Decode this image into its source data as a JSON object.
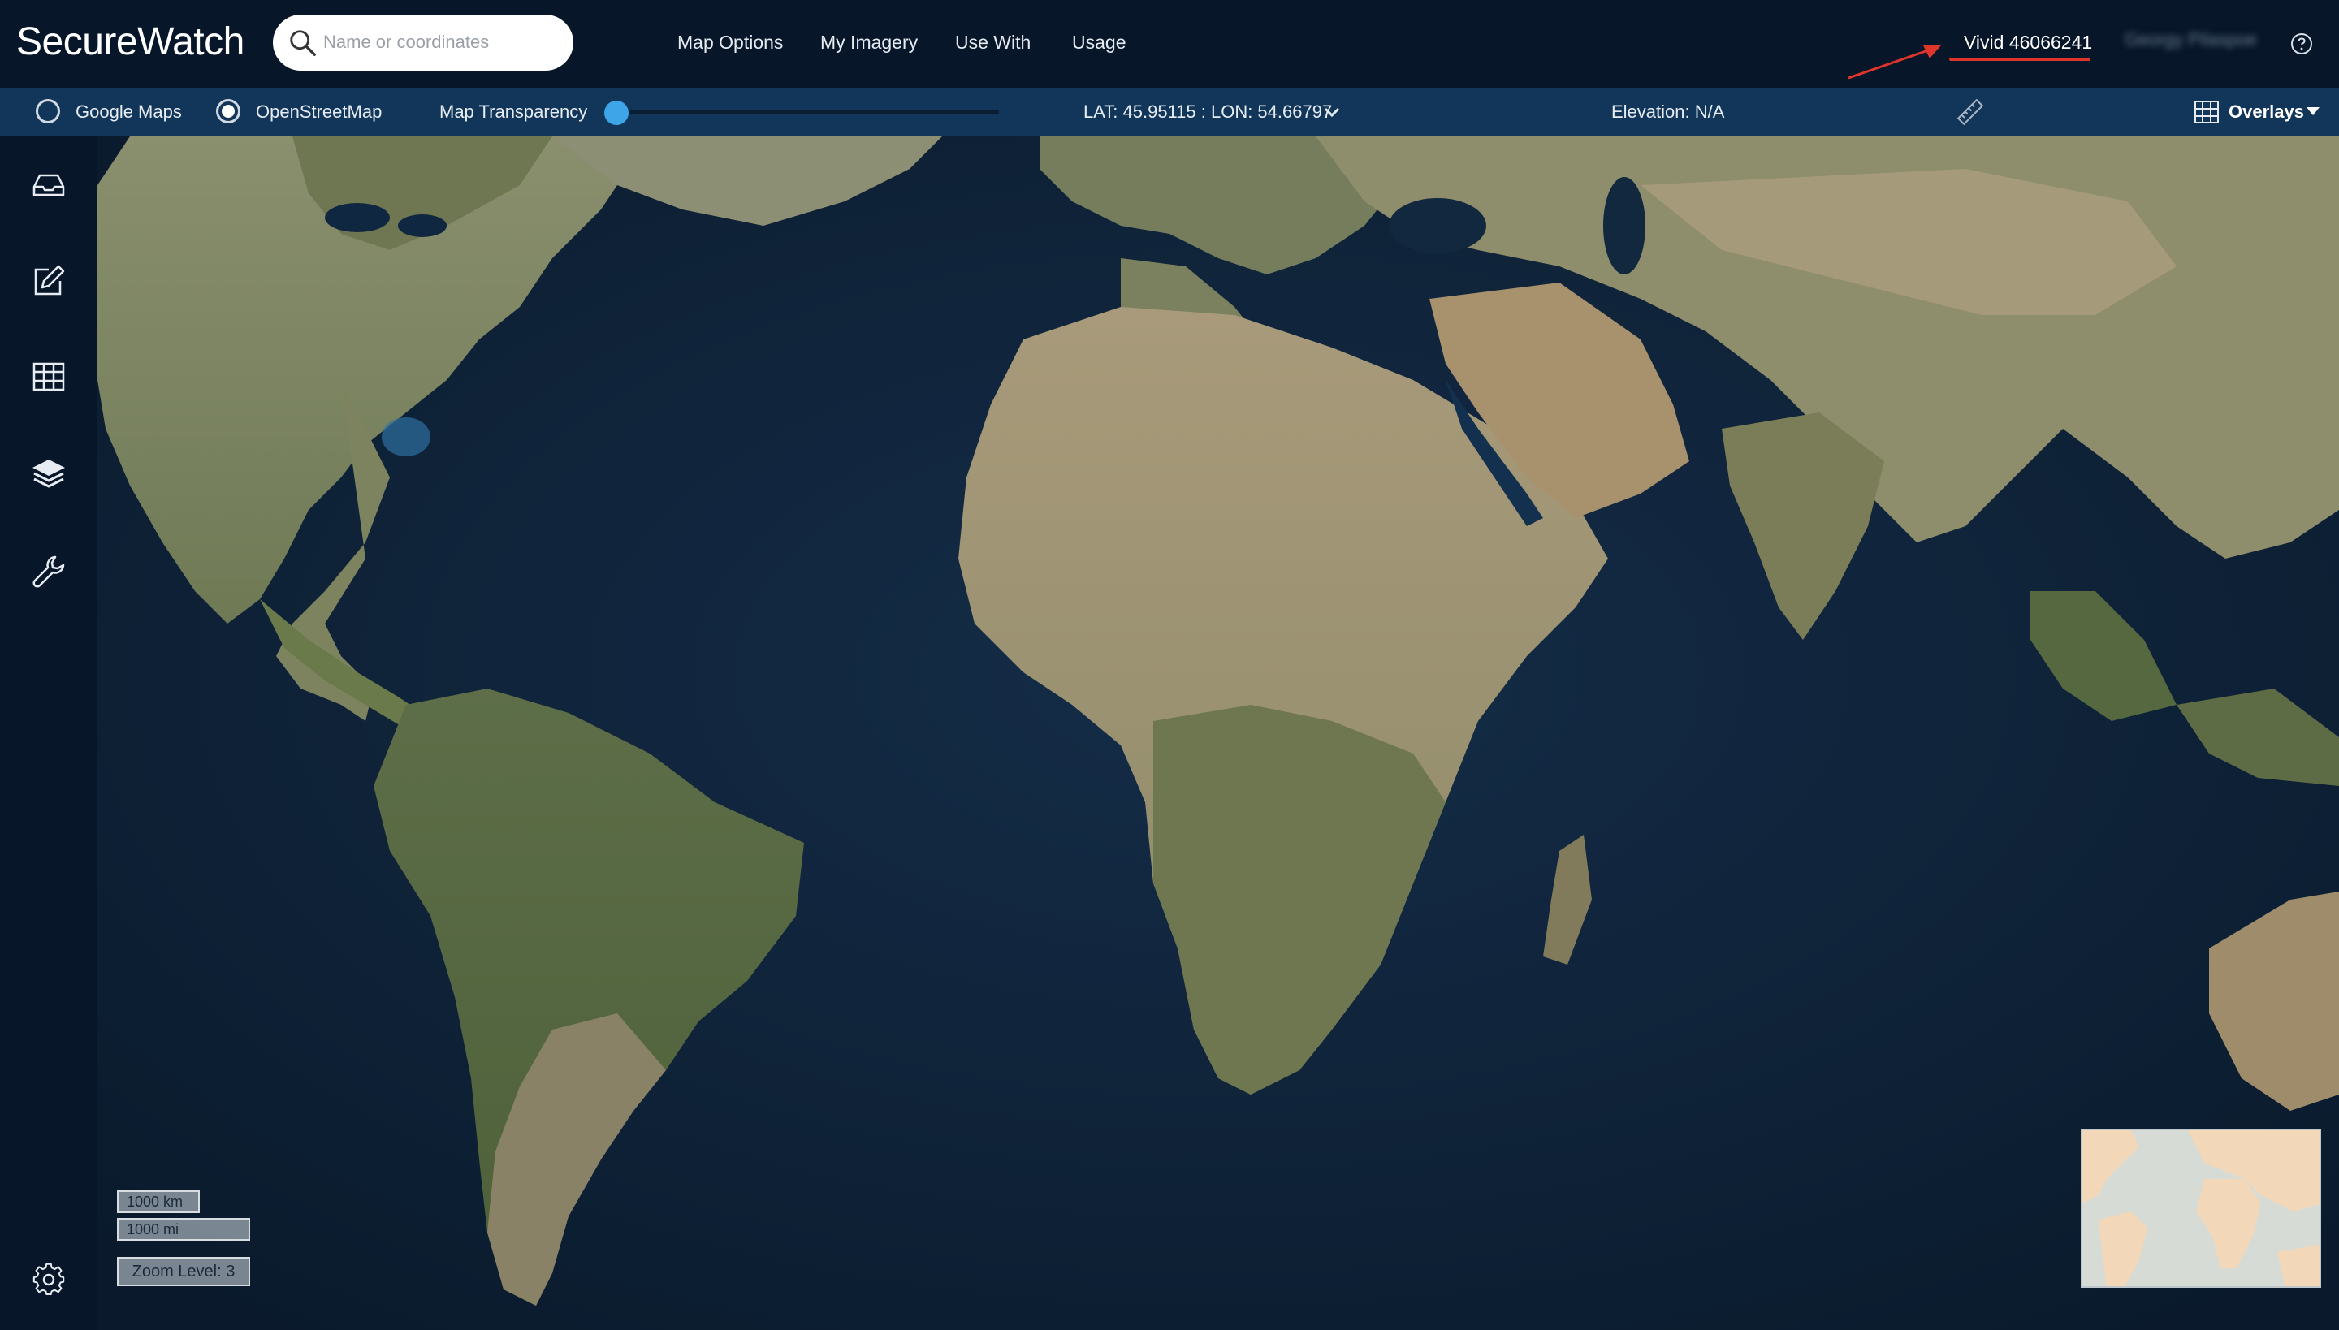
{
  "header": {
    "brand": "SecureWatch",
    "search_placeholder": "Name or coordinates",
    "nav": [
      "Map Options",
      "My Imagery",
      "Use With",
      "Usage"
    ],
    "account": "Vivid 46066241",
    "username": "Georgy Pilaspoe"
  },
  "subbar": {
    "basemaps": [
      {
        "label": "Google Maps",
        "selected": false
      },
      {
        "label": "OpenStreetMap",
        "selected": true
      }
    ],
    "transparency_label": "Map Transparency",
    "transparency_value": 0,
    "coordinates": "LAT: 45.95115 : LON: 54.66797",
    "elevation": "Elevation: N/A",
    "overlays_label": "Overlays"
  },
  "sidebar": {
    "icons": [
      "inbox-icon",
      "edit-icon",
      "table-icon",
      "layers-icon",
      "wrench-icon",
      "settings-icon"
    ]
  },
  "map": {
    "zoom_in": "+",
    "zoom_out": "−",
    "scale_km": "1000 km",
    "scale_mi": "1000 mi",
    "zoom_level": "Zoom Level: 3"
  },
  "colors": {
    "header_bg": "#071629",
    "subbar_bg": "#12355a",
    "ocean": "#0d2036",
    "slider": "#3da5e8",
    "annotation": "#e0352b"
  }
}
